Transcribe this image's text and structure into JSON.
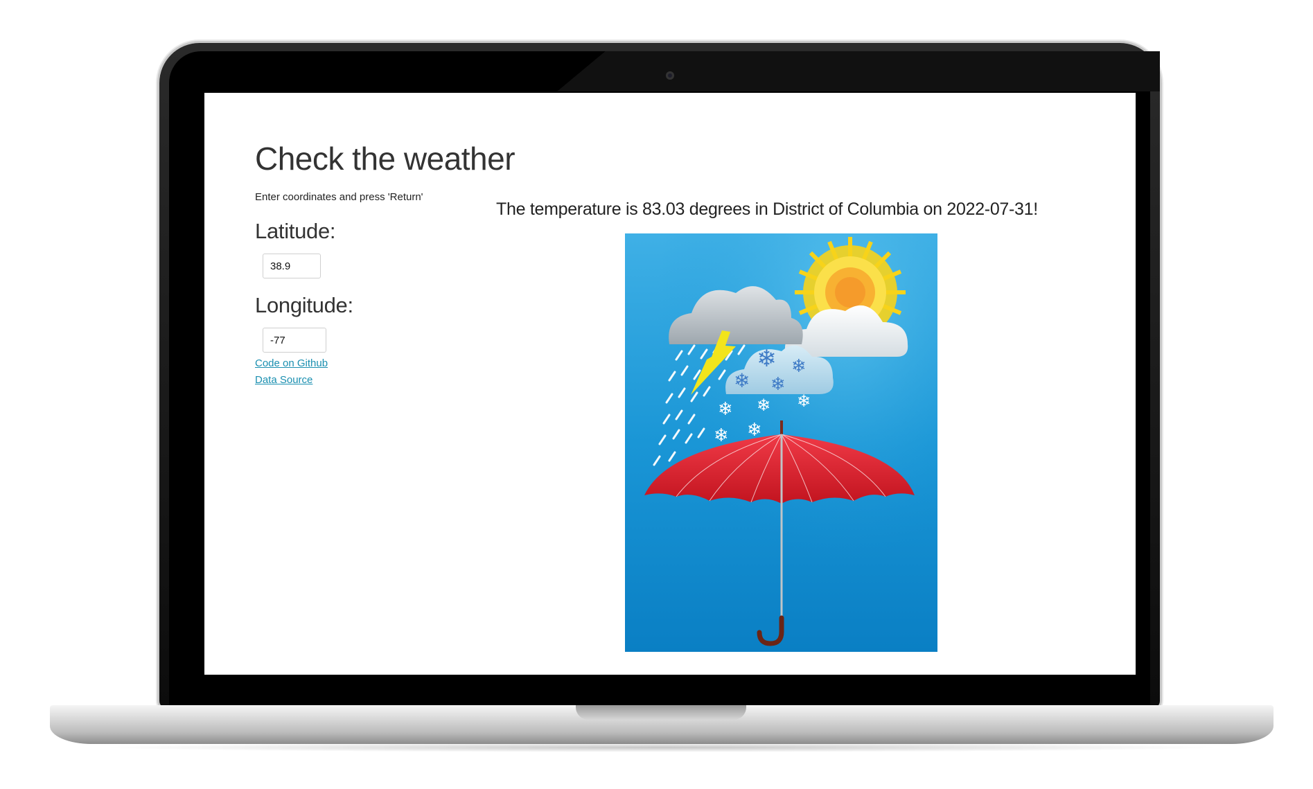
{
  "app": {
    "title": "Check the weather",
    "instructions": "Enter coordinates and press 'Return'"
  },
  "form": {
    "latitude": {
      "label": "Latitude:",
      "value": "38.9"
    },
    "longitude": {
      "label": "Longitude:",
      "value": "-77"
    }
  },
  "links": {
    "github": "Code on Github",
    "data_source": "Data Source"
  },
  "result": {
    "message": "The temperature is 83.03 degrees in District of Columbia on 2022-07-31!"
  },
  "image": {
    "icon": "weather-umbrella-illustration",
    "colors": {
      "sky": "#1a8fd0",
      "umbrella": "#d61f2c",
      "sun": "#f7c21a"
    }
  }
}
